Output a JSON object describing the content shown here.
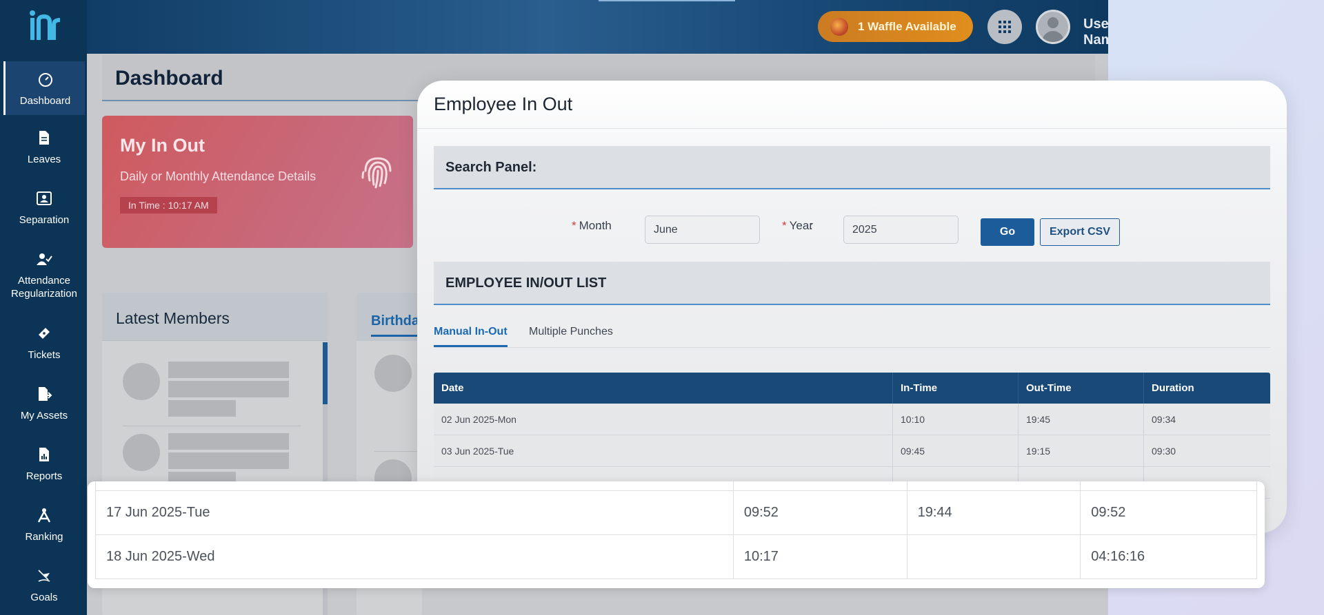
{
  "sidebar": {
    "logo_text": "hr",
    "items": [
      {
        "label": "Dashboard",
        "icon": "dashboard-gauge-icon"
      },
      {
        "label": "Leaves",
        "icon": "document-icon"
      },
      {
        "label": "Separation",
        "icon": "id-card-icon"
      },
      {
        "label": "Attendance Regularization",
        "icon": "user-check-icon"
      },
      {
        "label": "Tickets",
        "icon": "ticket-icon"
      },
      {
        "label": "My Assets",
        "icon": "asset-export-icon"
      },
      {
        "label": "Reports",
        "icon": "report-icon"
      },
      {
        "label": "Ranking",
        "icon": "ranking-compass-icon"
      },
      {
        "label": "Goals",
        "icon": "goal-flag-icon"
      }
    ]
  },
  "topbar": {
    "waffle_label": "1 Waffle Available",
    "user_name": "User Name"
  },
  "dashboard": {
    "title": "Dashboard",
    "in_out_card": {
      "title": "My In Out",
      "subtitle": "Daily or Monthly Attendance Details",
      "in_time": "In Time : 10:17 AM"
    },
    "latest_members_title": "Latest Members",
    "birthday_title": "Birthda"
  },
  "modal": {
    "title": "Employee In Out",
    "search_panel_title": "Search Panel:",
    "month_label": "Month",
    "month_value": "June",
    "year_label": "Year",
    "year_value": "2025",
    "go_label": "Go",
    "export_label": "Export CSV",
    "list_title": "EMPLOYEE IN/OUT LIST",
    "tabs": [
      "Manual In-Out",
      "Multiple Punches"
    ],
    "columns": [
      "Date",
      "In-Time",
      "Out-Time",
      "Duration"
    ],
    "rows": [
      [
        "02 Jun 2025-Mon",
        "10:10",
        "19:45",
        "09:34"
      ],
      [
        "03 Jun 2025-Tue",
        "09:45",
        "19:15",
        "09:30"
      ]
    ]
  },
  "zoomed_rows": [
    [
      "17 Jun 2025-Tue",
      "09:52",
      "19:44",
      "09:52"
    ],
    [
      "18 Jun 2025-Wed",
      "10:17",
      "",
      "04:16:16"
    ]
  ],
  "colors": {
    "sidebar_bg": "#0c3457",
    "table_header_bg": "#194a77",
    "accent_blue": "#1b69b3",
    "in_out_card": "#cf5a5e",
    "waffle_badge": "#e08e1d"
  }
}
